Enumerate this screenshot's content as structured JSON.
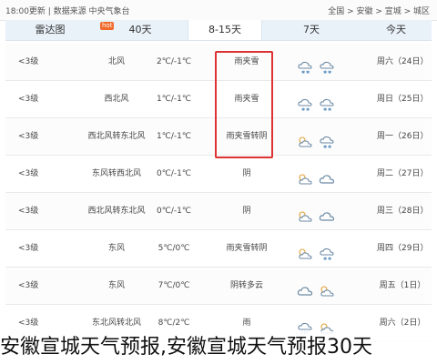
{
  "topbar": {
    "breadcrumb": "全国 > 安徽 > 宣城 > 城区",
    "update_info": "18:00更新 | 数据来源 中央气象台"
  },
  "tabs": [
    {
      "label": "今天"
    },
    {
      "label": "7天"
    },
    {
      "label": "8-15天"
    },
    {
      "label": "40天",
      "badge": "hot"
    },
    {
      "label": "雷达图"
    }
  ],
  "rows": [
    {
      "day": "周六（24日）",
      "icons": [
        "snow-cloud-icon",
        "snow-cloud-icon"
      ],
      "cond": "雨夹雪",
      "temp": "2℃/-1℃",
      "wind": "北风",
      "level": "<3级"
    },
    {
      "day": "周日（25日）",
      "icons": [
        "snow-cloud-icon",
        "snow-cloud-icon"
      ],
      "cond": "雨夹雪",
      "temp": "1℃/-1℃",
      "wind": "西北风",
      "level": "<3级"
    },
    {
      "day": "周一（26日）",
      "icons": [
        "partly-cloudy-icon",
        "snow-cloud-icon"
      ],
      "cond": "雨夹雪转阴",
      "temp": "1℃/-1℃",
      "wind": "西北风转东北风",
      "level": "<3级"
    },
    {
      "day": "周二（27日）",
      "icons": [
        "partly-cloudy-icon",
        "cloud-icon"
      ],
      "cond": "阴",
      "temp": "0℃/-1℃",
      "wind": "东风转西北风",
      "level": "<3级"
    },
    {
      "day": "周三（28日）",
      "icons": [
        "partly-cloudy-icon",
        "cloud-icon"
      ],
      "cond": "阴",
      "temp": "0℃/-1℃",
      "wind": "西北风转东北风",
      "level": "<3级"
    },
    {
      "day": "周四（29日）",
      "icons": [
        "partly-cloudy-icon",
        "snow-cloud-icon"
      ],
      "cond": "雨夹雪转阴",
      "temp": "5℃/0℃",
      "wind": "东风",
      "level": "<3级"
    },
    {
      "day": "周五（1日）",
      "icons": [
        "cloud-icon",
        "partly-cloudy-icon"
      ],
      "cond": "阴转多云",
      "temp": "7℃/0℃",
      "wind": "东风",
      "level": "<3级"
    },
    {
      "day": "周六（2日）",
      "icons": [
        "rain-cloud-icon",
        "partly-cloudy-icon"
      ],
      "cond": "雨",
      "temp": "8℃/2℃",
      "wind": "东北风转北风",
      "level": "<3级"
    }
  ],
  "caption": "安徽宣城天气预报,安徽宣城天气预报30天"
}
